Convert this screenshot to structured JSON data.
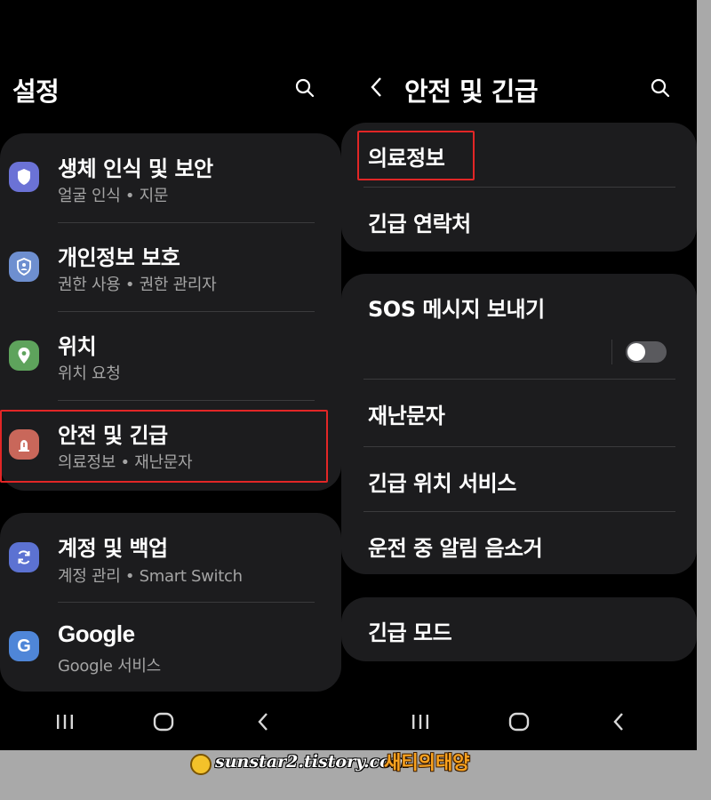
{
  "left": {
    "title": "설정",
    "card1": [
      {
        "title": "생체 인식 및 보안",
        "subtitle": "얼굴 인식  •  지문",
        "icon": "shield-icon"
      },
      {
        "title": "개인정보 보호",
        "subtitle": "권한 사용  •  권한 관리자",
        "icon": "privacy-shield-icon"
      },
      {
        "title": "위치",
        "subtitle": "위치 요청",
        "icon": "location-pin-icon"
      },
      {
        "title": "안전 및 긴급",
        "subtitle": "의료정보  •  재난문자",
        "icon": "emergency-icon"
      }
    ],
    "card2": [
      {
        "title": "계정 및 백업",
        "subtitle": "계정 관리  •  Smart Switch",
        "icon": "sync-icon"
      },
      {
        "title": "Google",
        "subtitle": "Google 서비스",
        "icon": "google-icon"
      }
    ]
  },
  "right": {
    "title": "안전 및 긴급",
    "card1": [
      "의료정보",
      "긴급 연락처"
    ],
    "card2": {
      "sos_label": "SOS 메시지 보내기",
      "sos_toggle": "off",
      "items": [
        "재난문자",
        "긴급 위치 서비스",
        "운전 중 알림 음소거"
      ]
    },
    "card3": [
      "긴급 모드"
    ]
  },
  "icons": {
    "biometrics": "#6b72d6",
    "privacy": "#6e8fd0",
    "location": "#5ea35c",
    "safety": "#c9675a",
    "accounts": "#5c72d2",
    "google": "#4f86d8"
  },
  "highlight_color": "#e22626",
  "watermark": {
    "url": "sunstar2.tistory.com",
    "name": "새티의태양"
  }
}
